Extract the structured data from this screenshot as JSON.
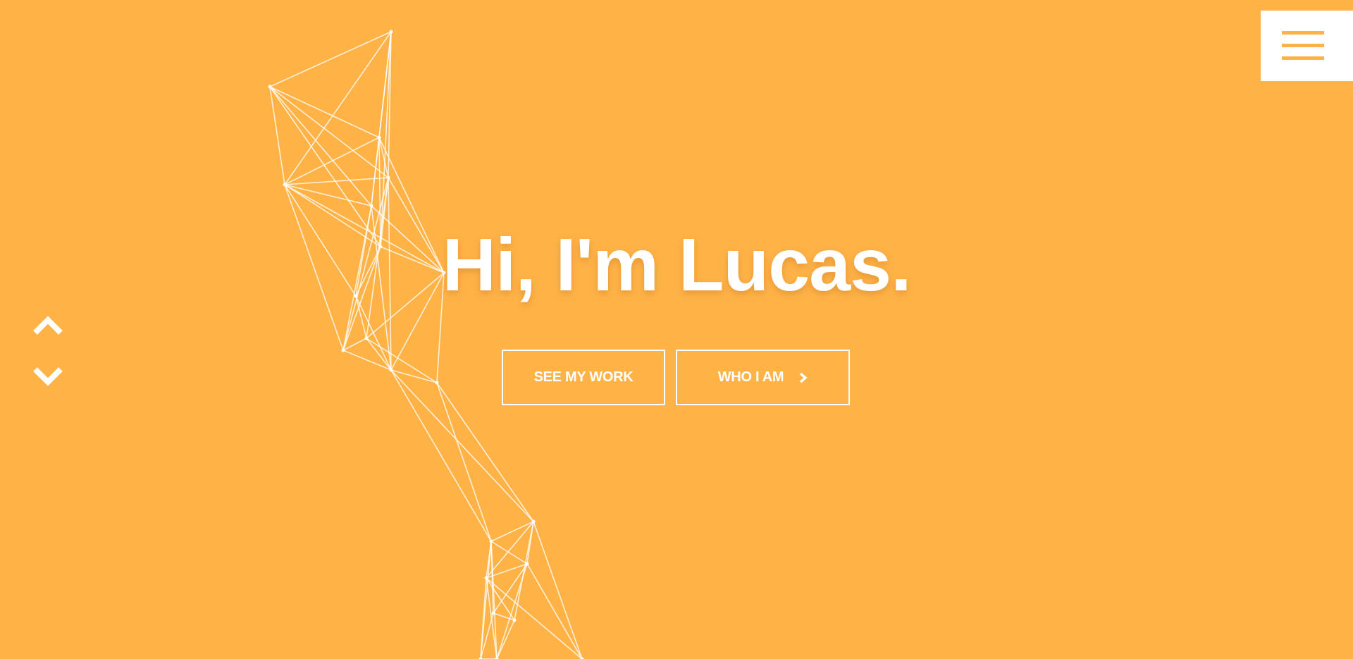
{
  "hero": {
    "headline": "Hi, I'm Lucas."
  },
  "buttons": {
    "see_work": "SEE MY WORK",
    "who_i_am": "WHO I AM"
  },
  "icons": {
    "menu": "hamburger-menu-icon",
    "scroll_up": "chevron-up-icon",
    "scroll_down": "chevron-down-icon",
    "button_arrow": "chevron-right-icon"
  },
  "colors": {
    "background": "#ffb347",
    "foreground": "#ffffff"
  }
}
